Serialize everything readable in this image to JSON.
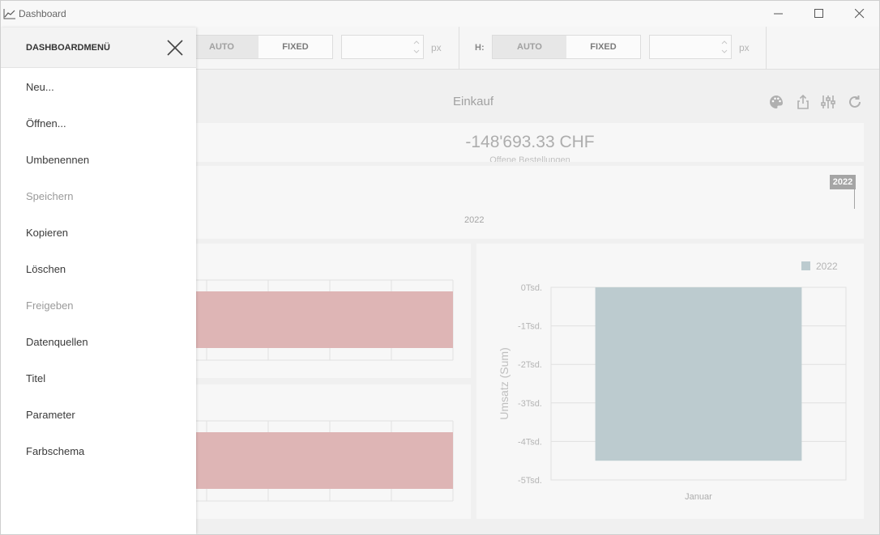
{
  "window": {
    "title": "Dashboard"
  },
  "toolbar": {
    "width_auto": "AUTO",
    "width_fixed": "FIXED",
    "width_unit": "px",
    "height_label": "H:",
    "height_auto": "AUTO",
    "height_fixed": "FIXED",
    "height_unit": "px"
  },
  "dashboard": {
    "title": "Einkauf",
    "kpi_value": "-148'693.33 CHF",
    "kpi_subtitle": "Offene Bestellungen",
    "range_year": "2022",
    "range_badge": "2022",
    "colors": {
      "bar_red": "#e2b8b8",
      "bar_blue": "#bfcfd3",
      "accent": "#a8a8a8"
    }
  },
  "chart_data": {
    "type": "bar",
    "categories": [
      "Januar"
    ],
    "series": [
      {
        "name": "2022",
        "values": [
          -4.5
        ]
      }
    ],
    "ylabel": "Umsatz (Sum)",
    "ylim": [
      -5,
      0
    ],
    "yticks": [
      "0Tsd.",
      "-1Tsd.",
      "-2Tsd.",
      "-3Tsd.",
      "-4Tsd.",
      "-5Tsd."
    ],
    "grid": true,
    "legend": "top-right"
  },
  "menu": {
    "title": "DASHBOARDMENÜ",
    "items": [
      {
        "label": "Neu...",
        "enabled": true
      },
      {
        "label": "Öffnen...",
        "enabled": true
      },
      {
        "label": "Umbenennen",
        "enabled": true
      },
      {
        "label": "Speichern",
        "enabled": false
      },
      {
        "label": "Kopieren",
        "enabled": true
      },
      {
        "label": "Löschen",
        "enabled": true
      },
      {
        "label": "Freigeben",
        "enabled": false
      },
      {
        "label": "Datenquellen",
        "enabled": true
      },
      {
        "label": "Titel",
        "enabled": true
      },
      {
        "label": "Parameter",
        "enabled": true
      },
      {
        "label": "Farbschema",
        "enabled": true
      }
    ]
  }
}
